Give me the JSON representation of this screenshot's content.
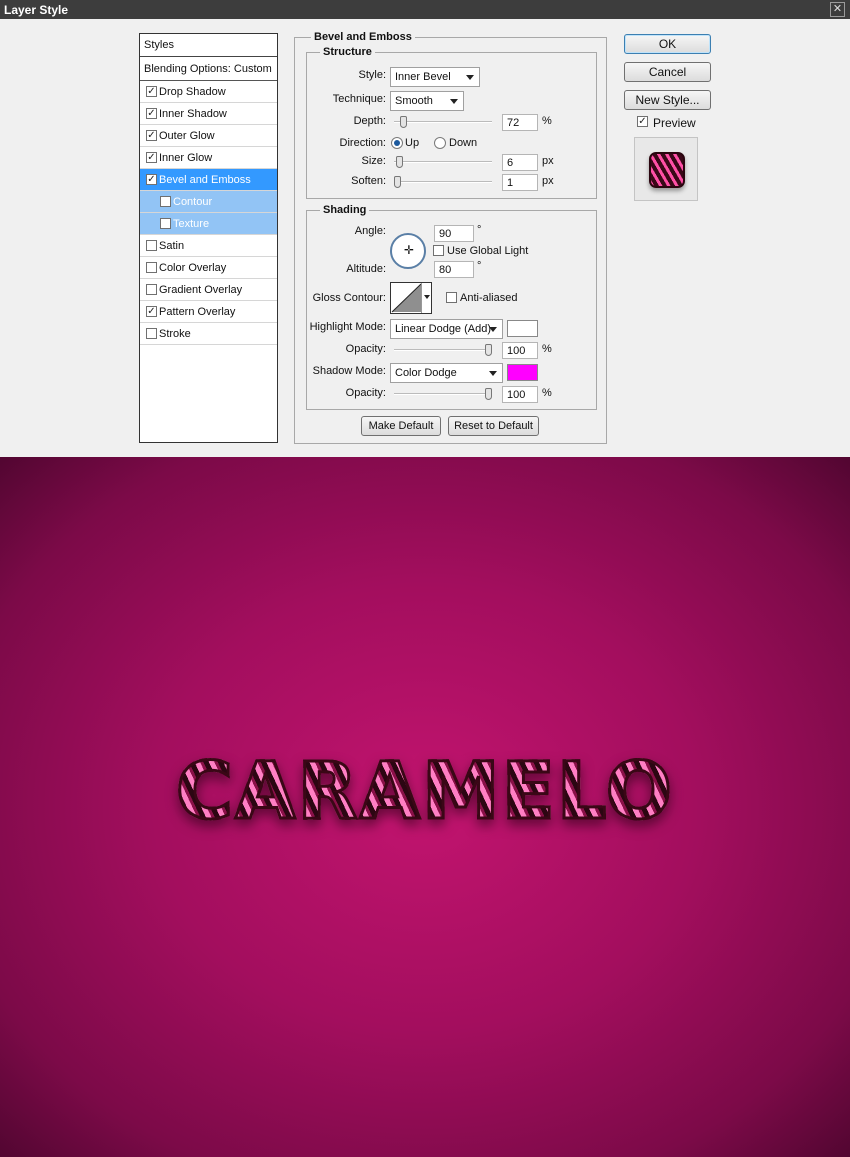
{
  "window": {
    "title": "Layer Style",
    "close_glyph": "✕"
  },
  "styles_list": {
    "header": "Styles",
    "blending": "Blending Options: Custom",
    "items": [
      {
        "label": "Drop Shadow",
        "checked": true
      },
      {
        "label": "Inner Shadow",
        "checked": true
      },
      {
        "label": "Outer Glow",
        "checked": true
      },
      {
        "label": "Inner Glow",
        "checked": true
      },
      {
        "label": "Bevel and Emboss",
        "checked": true,
        "selected": true
      },
      {
        "label": "Contour",
        "checked": false,
        "sub": true
      },
      {
        "label": "Texture",
        "checked": false,
        "sub": true
      },
      {
        "label": "Satin",
        "checked": false
      },
      {
        "label": "Color Overlay",
        "checked": false
      },
      {
        "label": "Gradient Overlay",
        "checked": false
      },
      {
        "label": "Pattern Overlay",
        "checked": true
      },
      {
        "label": "Stroke",
        "checked": false
      }
    ]
  },
  "panel": {
    "title": "Bevel and Emboss",
    "structure": {
      "title": "Structure",
      "style_label": "Style:",
      "style_value": "Inner Bevel",
      "technique_label": "Technique:",
      "technique_value": "Smooth",
      "depth_label": "Depth:",
      "depth_value": "72",
      "depth_unit": "%",
      "depth_level": 0.07,
      "direction_label": "Direction:",
      "direction_up": "Up",
      "direction_down": "Down",
      "direction_selected": "Up",
      "size_label": "Size:",
      "size_value": "6",
      "size_unit": "px",
      "size_level": 0.02,
      "soften_label": "Soften:",
      "soften_value": "1",
      "soften_unit": "px",
      "soften_level": 0.0
    },
    "shading": {
      "title": "Shading",
      "angle_label": "Angle:",
      "angle_value": "90",
      "angle_unit": "°",
      "global_light_label": "Use Global Light",
      "global_light": false,
      "altitude_label": "Altitude:",
      "altitude_value": "80",
      "altitude_unit": "°",
      "gloss_label": "Gloss Contour:",
      "anti_aliased_label": "Anti-aliased",
      "anti_aliased": false,
      "highlight_mode_label": "Highlight Mode:",
      "highlight_mode_value": "Linear Dodge (Add)",
      "highlight_color": "#ffffff",
      "highlight_opacity_label": "Opacity:",
      "highlight_opacity_value": "100",
      "highlight_opacity_unit": "%",
      "highlight_opacity_level": 1.0,
      "shadow_mode_label": "Shadow Mode:",
      "shadow_mode_value": "Color Dodge",
      "shadow_color": "#ff00ff",
      "shadow_opacity_label": "Opacity:",
      "shadow_opacity_value": "100",
      "shadow_opacity_unit": "%",
      "shadow_opacity_level": 1.0
    },
    "make_default": "Make Default",
    "reset_default": "Reset to Default"
  },
  "buttons": {
    "ok": "OK",
    "cancel": "Cancel",
    "new_style": "New Style...",
    "preview": "Preview",
    "preview_checked": true
  },
  "canvas": {
    "text": "CARAMELO",
    "background": "#a30e5e"
  },
  "icons": {
    "check": "✓"
  }
}
